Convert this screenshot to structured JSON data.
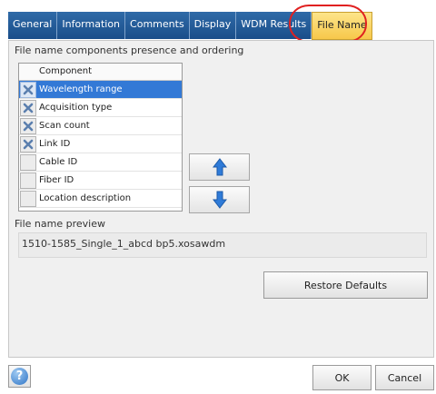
{
  "tabs": [
    {
      "label": "General",
      "active": false
    },
    {
      "label": "Information",
      "active": false
    },
    {
      "label": "Comments",
      "active": false
    },
    {
      "label": "Display",
      "active": false
    },
    {
      "label": "WDM Results",
      "active": false
    },
    {
      "label": "File Name",
      "active": true
    }
  ],
  "components_section": {
    "title": "File name components presence and ordering",
    "column_header": "Component",
    "rows": [
      {
        "label": "Wavelength range",
        "checked": true,
        "selected": true
      },
      {
        "label": "Acquisition type",
        "checked": true,
        "selected": false
      },
      {
        "label": "Scan count",
        "checked": true,
        "selected": false
      },
      {
        "label": "Link ID",
        "checked": true,
        "selected": false
      },
      {
        "label": "Cable ID",
        "checked": false,
        "selected": false
      },
      {
        "label": "Fiber ID",
        "checked": false,
        "selected": false
      },
      {
        "label": "Location description",
        "checked": false,
        "selected": false
      }
    ],
    "move_up_icon": "arrow-up-icon",
    "move_down_icon": "arrow-down-icon"
  },
  "preview": {
    "title": "File name preview",
    "value": "1510-1585_Single_1_abcd bp5.xosawdm"
  },
  "buttons": {
    "restore_defaults": "Restore Defaults",
    "ok": "OK",
    "cancel": "Cancel",
    "help_icon": "help-icon"
  },
  "colors": {
    "tab_blue": "#1a4e8a",
    "tab_active": "#f7c84a",
    "selection_blue": "#3379d6",
    "check_x": "#5b7fae",
    "arrow_blue": "#2f7bd8",
    "highlight_red": "#e02020"
  }
}
